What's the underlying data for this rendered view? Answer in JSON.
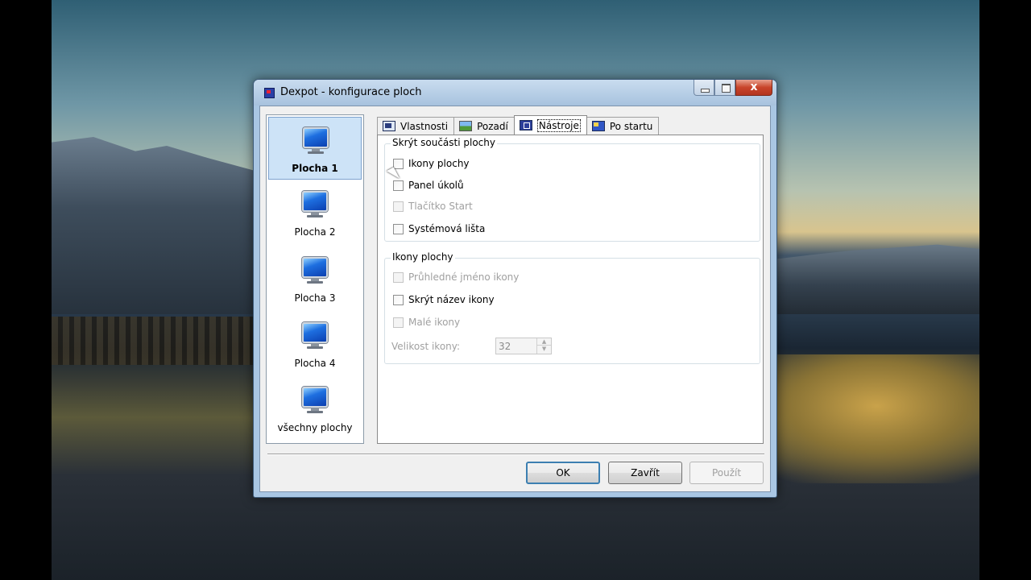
{
  "window": {
    "title": "Dexpot - konfigurace ploch",
    "close_glyph": "x",
    "icons": {
      "app": "dexpot-flag-icon",
      "minimize": "minimize-icon",
      "maximize": "maximize-icon",
      "close": "close-icon"
    }
  },
  "desktops": [
    {
      "label": "Plocha 1",
      "selected": true,
      "icon": "monitor-icon"
    },
    {
      "label": "Plocha 2",
      "selected": false,
      "icon": "monitor-icon"
    },
    {
      "label": "Plocha 3",
      "selected": false,
      "icon": "monitor-icon"
    },
    {
      "label": "Plocha 4",
      "selected": false,
      "icon": "monitor-icon"
    },
    {
      "label": "všechny plochy",
      "selected": false,
      "icon": "monitor-icon"
    }
  ],
  "tabs": [
    {
      "label": "Vlastnosti",
      "active": false,
      "icon": "properties-icon"
    },
    {
      "label": "Pozadí",
      "active": false,
      "icon": "background-icon"
    },
    {
      "label": "Nástroje",
      "active": true,
      "icon": "tools-icon"
    },
    {
      "label": "Po startu",
      "active": false,
      "icon": "startup-icon"
    }
  ],
  "hide_group": {
    "title": "Skrýt součásti plochy",
    "items": [
      {
        "label": "Ikony plochy",
        "checked": false,
        "enabled": true
      },
      {
        "label": "Panel úkolů",
        "checked": false,
        "enabled": true
      },
      {
        "label": "Tlačítko Start",
        "checked": false,
        "enabled": false
      },
      {
        "label": "Systémová lišta",
        "checked": false,
        "enabled": true
      }
    ]
  },
  "icons_group": {
    "title": "Ikony plochy",
    "items": [
      {
        "label": "Průhledné jméno ikony",
        "checked": false,
        "enabled": false
      },
      {
        "label": "Skrýt název ikony",
        "checked": false,
        "enabled": true
      },
      {
        "label": "Malé ikony",
        "checked": false,
        "enabled": false
      }
    ],
    "size_label": "Velikost ikony:",
    "size_value": "32",
    "spin_up": "▲",
    "spin_down": "▼"
  },
  "buttons": {
    "ok": "OK",
    "close": "Zavřít",
    "apply": "Použít"
  },
  "colors": {
    "selection": "#cde3f7",
    "default_button_border": "#3c7fb1",
    "disabled_text": "#a0a0a0"
  }
}
